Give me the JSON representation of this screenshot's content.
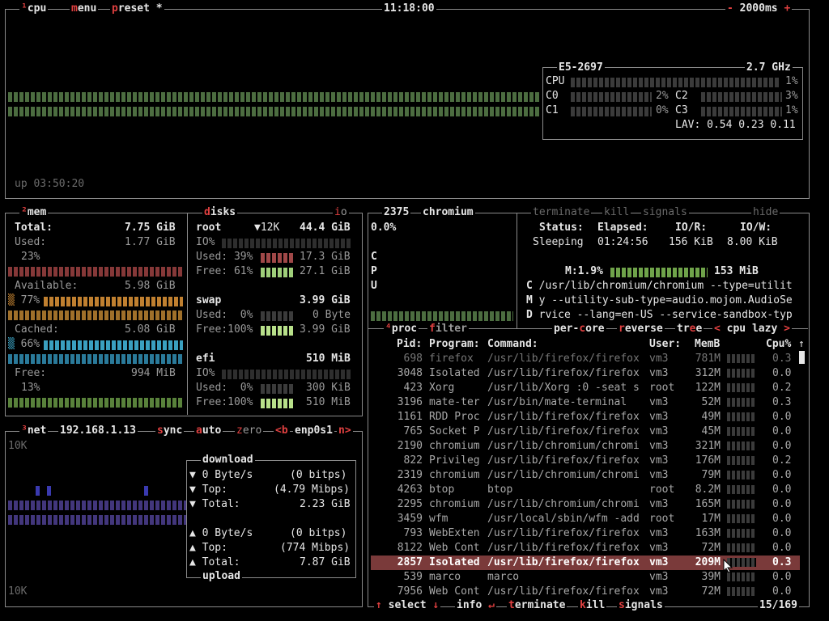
{
  "cpu_box": {
    "tab_cpu": "cpu",
    "tab_menu": "menu",
    "tab_preset": "preset *",
    "clock": "11:18:00",
    "refresh": "2000ms",
    "uptime": "up 03:50:20",
    "cpu_model": "E5-2697",
    "cpu_freq": "2.7 GHz",
    "cpu_total_label": "CPU",
    "cpu_total_pct": "1%",
    "cores": [
      {
        "label": "C0",
        "pct": "2%"
      },
      {
        "label": "C2",
        "pct": "3%"
      },
      {
        "label": "C1",
        "pct": "0%"
      },
      {
        "label": "C3",
        "pct": "1%"
      }
    ],
    "lav_label": "LAV:",
    "lav_values": "0.54 0.23 0.11"
  },
  "mem_box": {
    "title": "mem",
    "total_label": "Total:",
    "total_val": "7.75 GiB",
    "used_label": "Used:",
    "used_val": "1.77 GiB",
    "used_pct": "23%",
    "avail_label": "Available:",
    "avail_val": "5.98 GiB",
    "avail_pct": "77%",
    "cached_label": "Cached:",
    "cached_val": "5.08 GiB",
    "cached_pct": "66%",
    "free_label": "Free:",
    "free_val": "994 MiB",
    "free_pct": "13%"
  },
  "disks_box": {
    "title": "disks",
    "io_tab": "io",
    "root_label": "root",
    "root_io": "▼12K",
    "root_total": "44.4 GiB",
    "root_io_label": "IO%",
    "root_used": "Used: 39%",
    "root_used_val": "17.3 GiB",
    "root_free": "Free: 61%",
    "root_free_val": "27.1 GiB",
    "swap_label": "swap",
    "swap_total": "3.99 GiB",
    "swap_used": "Used:  0%",
    "swap_used_val": "0 Byte",
    "swap_free": "Free:100%",
    "swap_free_val": "3.99 GiB",
    "efi_label": "efi",
    "efi_total": "510 MiB",
    "efi_io_label": "IO%",
    "efi_used": "Used:  0%",
    "efi_used_val": "300 KiB",
    "efi_free": "Free:100%",
    "efi_free_val": "510 MiB"
  },
  "net_box": {
    "title": "net",
    "ip": "192.168.1.13",
    "sync": "sync",
    "auto": "auto",
    "zero": "zero",
    "prev": "<b",
    "iface": "enp0s1",
    "next": "n>",
    "scale_top": "10K",
    "scale_bottom": "10K",
    "download_title": "download",
    "dl_rate": "0 Byte/s",
    "dl_rate_bits": "(0 bitps)",
    "dl_top_label": "Top:",
    "dl_top": "(4.79 Mibps)",
    "dl_total_label": "Total:",
    "dl_total": "2.23 GiB",
    "ul_rate": "0 Byte/s",
    "ul_rate_bits": "(0 bitps)",
    "ul_top_label": "Top:",
    "ul_top": "(774 Mibps)",
    "ul_total_label": "Total:",
    "ul_total": "7.87 GiB",
    "upload_title": "upload"
  },
  "detail_box": {
    "pid": "2375",
    "name": "chromium",
    "cpu_pct": "0.0%",
    "cpu_vert": [
      "C",
      "P",
      "U"
    ],
    "btn_terminate": "terminate",
    "btn_kill": "kill",
    "btn_signals": "signals",
    "btn_hide": "hide",
    "status_label": "Status:",
    "elapsed_label": "Elapsed:",
    "ior_label": "IO/R:",
    "iow_label": "IO/W:",
    "status": "Sleeping",
    "elapsed": "01:24:56",
    "ior": "156 KiB",
    "iow": "8.00 KiB",
    "mem_label": "M:1.9%",
    "mem_val": "153 MiB",
    "cmd_lines": [
      {
        "k": "C",
        "v": "/usr/lib/chromium/chromium --type=utilit"
      },
      {
        "k": "M",
        "v": "y --utility-sub-type=audio.mojom.AudioSe"
      },
      {
        "k": "D",
        "v": "rvice --lang=en-US --service-sandbox-typ"
      }
    ]
  },
  "proc_box": {
    "title": "proc",
    "filter": "filter",
    "per_core": "per-core",
    "reverse": "reverse",
    "tree": "tree",
    "sort_left": "<",
    "sort": "cpu lazy",
    "sort_right": ">",
    "headers": {
      "pid": "Pid:",
      "program": "Program:",
      "command": "Command:",
      "user": "User:",
      "mem": "MemB",
      "cpu": "Cpu%"
    },
    "rows": [
      {
        "pid": "698",
        "program": "firefox",
        "command": "/usr/lib/firefox/firefox",
        "user": "vm3",
        "mem": "781M",
        "cpu": "0.3"
      },
      {
        "pid": "3048",
        "program": "Isolated",
        "command": "/usr/lib/firefox/firefox",
        "user": "vm3",
        "mem": "312M",
        "cpu": "0.0"
      },
      {
        "pid": "423",
        "program": "Xorg",
        "command": "/usr/lib/Xorg :0 -seat s",
        "user": "root",
        "mem": "122M",
        "cpu": "0.2"
      },
      {
        "pid": "3196",
        "program": "mate-ter",
        "command": "/usr/bin/mate-terminal",
        "user": "vm3",
        "mem": "52M",
        "cpu": "0.3"
      },
      {
        "pid": "1161",
        "program": "RDD Proc",
        "command": "/usr/lib/firefox/firefox",
        "user": "vm3",
        "mem": "49M",
        "cpu": "0.0"
      },
      {
        "pid": "765",
        "program": "Socket P",
        "command": "/usr/lib/firefox/firefox",
        "user": "vm3",
        "mem": "45M",
        "cpu": "0.0"
      },
      {
        "pid": "2190",
        "program": "chromium",
        "command": "/usr/lib/chromium/chromi",
        "user": "vm3",
        "mem": "321M",
        "cpu": "0.0"
      },
      {
        "pid": "822",
        "program": "Privileg",
        "command": "/usr/lib/firefox/firefox",
        "user": "vm3",
        "mem": "176M",
        "cpu": "0.2"
      },
      {
        "pid": "2319",
        "program": "chromium",
        "command": "/usr/lib/chromium/chromi",
        "user": "vm3",
        "mem": "79M",
        "cpu": "0.0"
      },
      {
        "pid": "4263",
        "program": "btop",
        "command": "btop",
        "user": "root",
        "mem": "8.2M",
        "cpu": "0.0"
      },
      {
        "pid": "2295",
        "program": "chromium",
        "command": "/usr/lib/chromium/chromi",
        "user": "vm3",
        "mem": "165M",
        "cpu": "0.0"
      },
      {
        "pid": "3459",
        "program": "wfm",
        "command": "/usr/local/sbin/wfm -add",
        "user": "root",
        "mem": "17M",
        "cpu": "0.0"
      },
      {
        "pid": "793",
        "program": "WebExten",
        "command": "/usr/lib/firefox/firefox",
        "user": "vm3",
        "mem": "163M",
        "cpu": "0.0"
      },
      {
        "pid": "8122",
        "program": "Web Cont",
        "command": "/usr/lib/firefox/firefox",
        "user": "vm3",
        "mem": "72M",
        "cpu": "0.0"
      },
      {
        "pid": "2857",
        "program": "Isolated",
        "command": "/usr/lib/firefox/firefox",
        "user": "vm3",
        "mem": "209M",
        "cpu": "0.3"
      },
      {
        "pid": "539",
        "program": "marco",
        "command": "marco",
        "user": "vm3",
        "mem": "39M",
        "cpu": "0.0"
      },
      {
        "pid": "7956",
        "program": "Web Cont",
        "command": "/usr/lib/firefox/firefox",
        "user": "vm3",
        "mem": "72M",
        "cpu": "0.0"
      }
    ],
    "selected_index": 14,
    "footer_select": "select",
    "footer_info": "info",
    "footer_terminate": "terminate",
    "footer_kill": "kill",
    "footer_signals": "signals",
    "count": "15/169"
  },
  "colors": {
    "accent": "#e04040",
    "highlight": "#7a3a3a",
    "green": "#6fa34a",
    "cyan": "#3aa0c0",
    "orange": "#c08030"
  }
}
